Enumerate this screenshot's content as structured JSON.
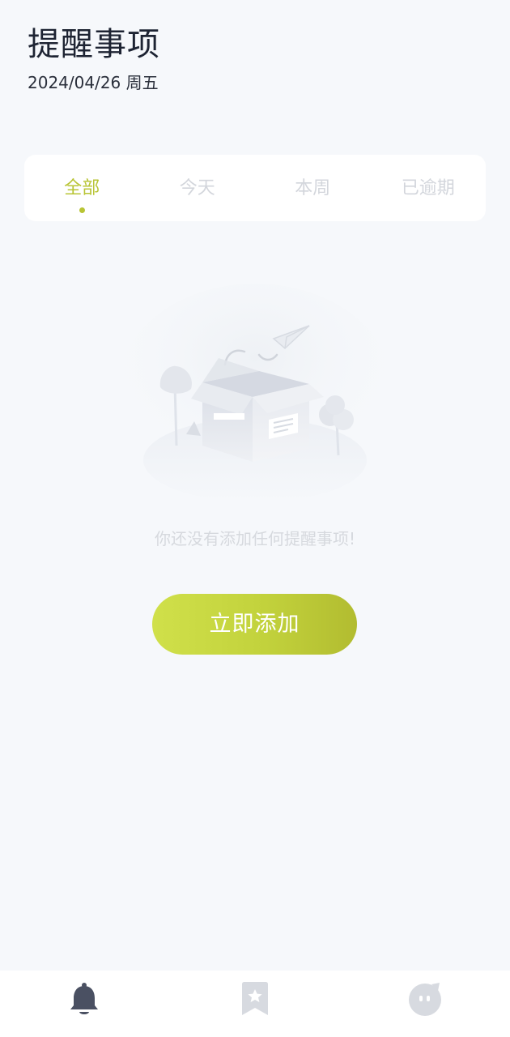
{
  "header": {
    "title": "提醒事项",
    "date": "2024/04/26 周五"
  },
  "tabs": [
    {
      "label": "全部",
      "active": true
    },
    {
      "label": "今天",
      "active": false
    },
    {
      "label": "本周",
      "active": false
    },
    {
      "label": "已逾期",
      "active": false
    }
  ],
  "empty_state": {
    "message": "你还没有添加任何提醒事项!",
    "illustration": "empty-box-illustration"
  },
  "add_button": {
    "label": "立即添加"
  },
  "bottom_nav": [
    {
      "name": "reminders",
      "icon": "bell-icon",
      "active": true
    },
    {
      "name": "favorites",
      "icon": "bookmark-star-icon",
      "active": false
    },
    {
      "name": "profile",
      "icon": "face-icon",
      "active": false
    }
  ],
  "colors": {
    "accent": "#b8c434",
    "background": "#f6f8fb",
    "title": "#1e2433",
    "inactive_tab": "#d3d6dc",
    "nav_active": "#4a5062",
    "nav_inactive": "#d7dae0"
  }
}
